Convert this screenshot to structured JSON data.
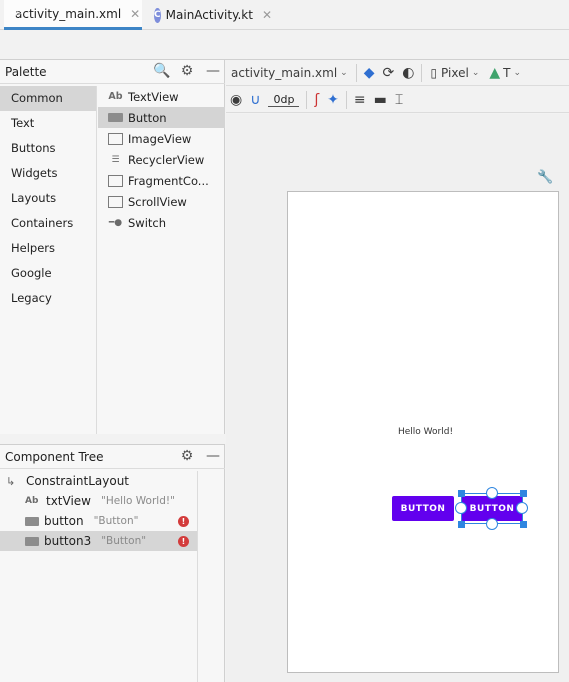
{
  "tabs": [
    {
      "label": "activity_main.xml",
      "active": true
    },
    {
      "label": "MainActivity.kt",
      "active": false
    }
  ],
  "palette": {
    "title": "Palette",
    "categories": [
      "Common",
      "Text",
      "Buttons",
      "Widgets",
      "Layouts",
      "Containers",
      "Helpers",
      "Google",
      "Legacy"
    ],
    "selected_category": "Common",
    "items": [
      "TextView",
      "Button",
      "ImageView",
      "RecyclerView",
      "FragmentCo...",
      "ScrollView",
      "Switch"
    ],
    "selected_item": "Button"
  },
  "component_tree": {
    "title": "Component Tree",
    "root": "ConstraintLayout",
    "children": [
      {
        "name": "txtView",
        "hint": "\"Hello World!\"",
        "icon": "textview-icon",
        "error": false
      },
      {
        "name": "button",
        "hint": "\"Button\"",
        "icon": "button-icon",
        "error": true
      },
      {
        "name": "button3",
        "hint": "\"Button\"",
        "icon": "button-icon",
        "error": true
      }
    ]
  },
  "design_toolbar": {
    "file": "activity_main.xml",
    "device": "Pixel",
    "api": "T",
    "margin": "0dp"
  },
  "canvas": {
    "hello_text": "Hello World!",
    "button1": "BUTTON",
    "button2": "BUTTON"
  },
  "colors": {
    "accent": "#2f86e0",
    "button": "#6200ee",
    "error": "#d33c3c"
  }
}
